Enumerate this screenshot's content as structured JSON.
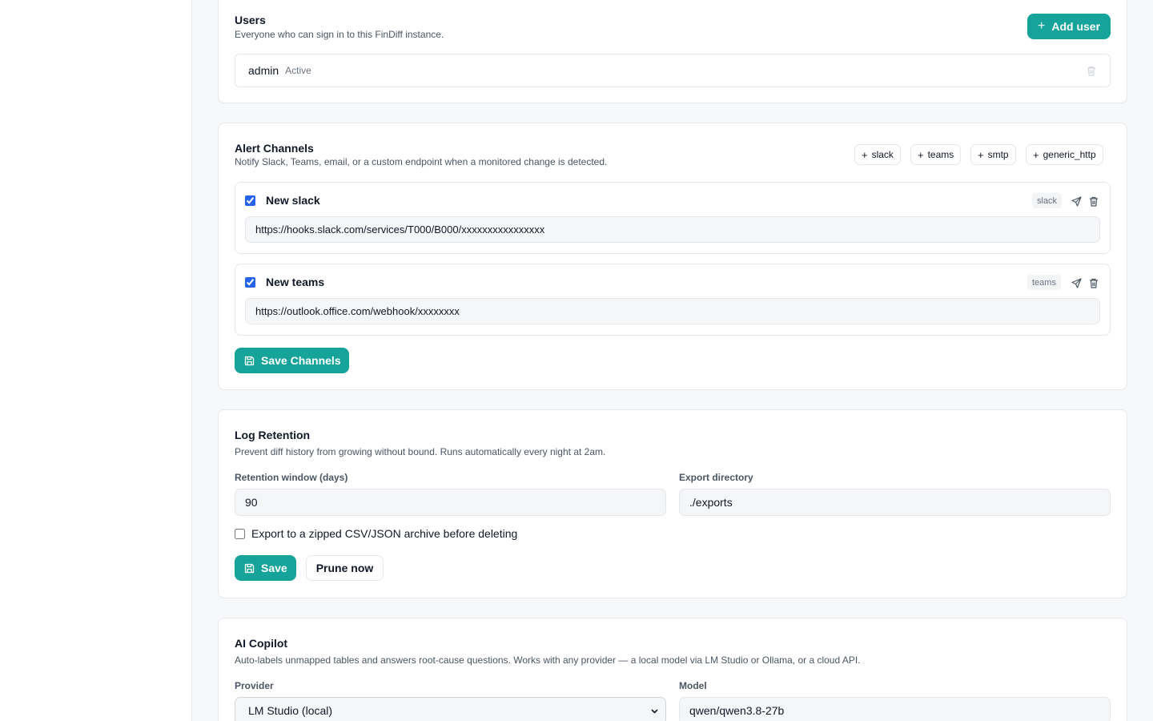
{
  "users": {
    "title": "Users",
    "description": "Everyone who can sign in to this FinDiff instance.",
    "add_label": "Add user",
    "list": [
      {
        "name": "admin",
        "status": "Active"
      }
    ]
  },
  "alert_channels": {
    "title": "Alert Channels",
    "description": "Notify Slack, Teams, email, or a custom endpoint when a monitored change is detected.",
    "add_types": [
      "slack",
      "teams",
      "smtp",
      "generic_http"
    ],
    "channels": [
      {
        "enabled": true,
        "name": "New slack",
        "type": "slack",
        "url": "https://hooks.slack.com/services/T000/B000/xxxxxxxxxxxxxxxx"
      },
      {
        "enabled": true,
        "name": "New teams",
        "type": "teams",
        "url": "https://outlook.office.com/webhook/xxxxxxxx"
      }
    ],
    "save_label": "Save Channels"
  },
  "log_retention": {
    "title": "Log Retention",
    "description": "Prevent diff history from growing without bound. Runs automatically every night at 2am.",
    "retention_label": "Retention window (days)",
    "retention_value": "90",
    "export_dir_label": "Export directory",
    "export_dir_value": "./exports",
    "export_checkbox_label": "Export to a zipped CSV/JSON archive before deleting",
    "export_checked": false,
    "save_label": "Save",
    "prune_label": "Prune now"
  },
  "ai_copilot": {
    "title": "AI Copilot",
    "description": "Auto-labels unmapped tables and answers root-cause questions. Works with any provider — a local model via LM Studio or Ollama, or a cloud API.",
    "provider_label": "Provider",
    "provider_value": "LM Studio (local)",
    "model_label": "Model",
    "model_value": "qwen/qwen3.8-27b"
  },
  "colors": {
    "accent": "#16a39a",
    "checkbox": "#2563eb",
    "card_border": "#e5e7eb"
  },
  "icons": {
    "add": "plus-icon",
    "delete": "trash-icon",
    "test": "send-icon",
    "save": "save-icon",
    "dropdown": "chevron-down-icon"
  }
}
